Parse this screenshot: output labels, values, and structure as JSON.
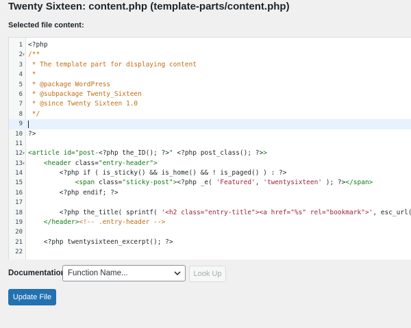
{
  "page_title": "Twenty Sixteen: content.php (template-parts/content.php)",
  "section_label": "Selected file content:",
  "editor": {
    "lines": [
      {
        "n": "1",
        "fold": "",
        "segs": [
          {
            "t": "<?php",
            "c": "php"
          }
        ]
      },
      {
        "n": "2",
        "fold": "▾",
        "segs": [
          {
            "t": "/**",
            "c": "comment"
          }
        ]
      },
      {
        "n": "3",
        "fold": "",
        "segs": [
          {
            "t": " * The template part for displaying content",
            "c": "comment"
          }
        ]
      },
      {
        "n": "4",
        "fold": "",
        "segs": [
          {
            "t": " *",
            "c": "comment"
          }
        ]
      },
      {
        "n": "5",
        "fold": "",
        "segs": [
          {
            "t": " * @package WordPress",
            "c": "comment"
          }
        ]
      },
      {
        "n": "6",
        "fold": "",
        "segs": [
          {
            "t": " * @subpackage Twenty_Sixteen",
            "c": "comment"
          }
        ]
      },
      {
        "n": "7",
        "fold": "",
        "segs": [
          {
            "t": " * @since Twenty Sixteen 1.0",
            "c": "comment"
          }
        ]
      },
      {
        "n": "8",
        "fold": "",
        "segs": [
          {
            "t": " */",
            "c": "comment"
          }
        ]
      },
      {
        "n": "9",
        "fold": "",
        "segs": [],
        "active": true
      },
      {
        "n": "10",
        "fold": "",
        "segs": [
          {
            "t": "?>",
            "c": "php"
          }
        ]
      },
      {
        "n": "11",
        "fold": "",
        "segs": []
      },
      {
        "n": "12",
        "fold": "▾",
        "segs": [
          {
            "t": "<article ",
            "c": "html"
          },
          {
            "t": "id=\"post-",
            "c": "html"
          },
          {
            "t": "<?php the_ID(); ?>",
            "c": "php"
          },
          {
            "t": "\" ",
            "c": "html"
          },
          {
            "t": "<?php post_class(); ?>",
            "c": "php"
          },
          {
            "t": ">",
            "c": "html"
          }
        ]
      },
      {
        "n": "13",
        "fold": "▾",
        "segs": [
          {
            "t": "    <header ",
            "c": "html"
          },
          {
            "t": "class=",
            "c": "attr"
          },
          {
            "t": "\"entry-header\"",
            "c": "html"
          },
          {
            "t": ">",
            "c": "html"
          }
        ]
      },
      {
        "n": "14",
        "fold": "",
        "segs": [
          {
            "t": "        <?php if ( is_sticky() && is_home() && ! is_paged() ) : ?>",
            "c": "php"
          }
        ]
      },
      {
        "n": "15",
        "fold": "",
        "segs": [
          {
            "t": "            <span ",
            "c": "html"
          },
          {
            "t": "class=",
            "c": "attr"
          },
          {
            "t": "\"sticky-post\"",
            "c": "html"
          },
          {
            "t": ">",
            "c": "html"
          },
          {
            "t": "<?php _e( ",
            "c": "php"
          },
          {
            "t": "'Featured'",
            "c": "str"
          },
          {
            "t": ", ",
            "c": "php"
          },
          {
            "t": "'twentysixteen'",
            "c": "str"
          },
          {
            "t": " ); ?>",
            "c": "php"
          },
          {
            "t": "</span>",
            "c": "html"
          }
        ]
      },
      {
        "n": "16",
        "fold": "",
        "segs": [
          {
            "t": "        <?php endif; ?>",
            "c": "php"
          }
        ]
      },
      {
        "n": "17",
        "fold": "",
        "segs": []
      },
      {
        "n": "18",
        "fold": "",
        "segs": [
          {
            "t": "        <?php the_title( sprintf( ",
            "c": "php"
          },
          {
            "t": "'<h2 class=\"entry-title\"><a href=\"%s\" rel=\"bookmark\">'",
            "c": "str"
          },
          {
            "t": ", esc_url(",
            "c": "php"
          }
        ]
      },
      {
        "n": "19",
        "fold": "",
        "segs": [
          {
            "t": "    </header>",
            "c": "html"
          },
          {
            "t": "<!-- .entry-header -->",
            "c": "comment"
          }
        ]
      },
      {
        "n": "20",
        "fold": "",
        "segs": []
      },
      {
        "n": "21",
        "fold": "",
        "segs": [
          {
            "t": "    <?php twentysixteen_excerpt(); ?>",
            "c": "php"
          }
        ]
      },
      {
        "n": "22",
        "fold": "",
        "segs": []
      }
    ]
  },
  "documentation": {
    "label": "Documentation:",
    "select_value": "Function Name...",
    "lookup_label": "Look Up"
  },
  "update_button_label": "Update File",
  "colors": {
    "primary": "#2271b1",
    "comment": "#c26d13",
    "html_tag": "#117a14",
    "active_line": "#e8f2fe"
  }
}
